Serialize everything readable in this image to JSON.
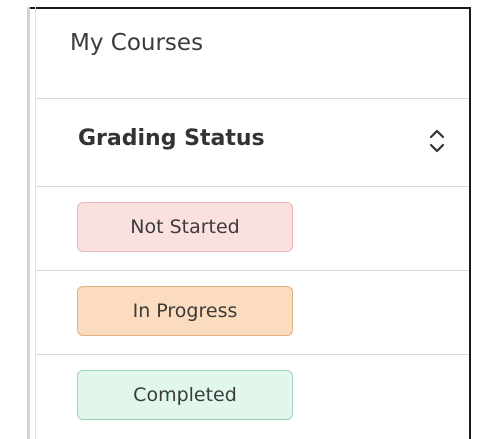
{
  "page": {
    "title": "My Courses"
  },
  "table": {
    "column_header": "Grading Status",
    "sort_icon": "sort-updown-icon",
    "statuses": [
      {
        "label": "Not Started",
        "color": "#fbe0e0"
      },
      {
        "label": "In Progress",
        "color": "#fcdcbf"
      },
      {
        "label": "Completed",
        "color": "#e1f7ec"
      }
    ]
  }
}
